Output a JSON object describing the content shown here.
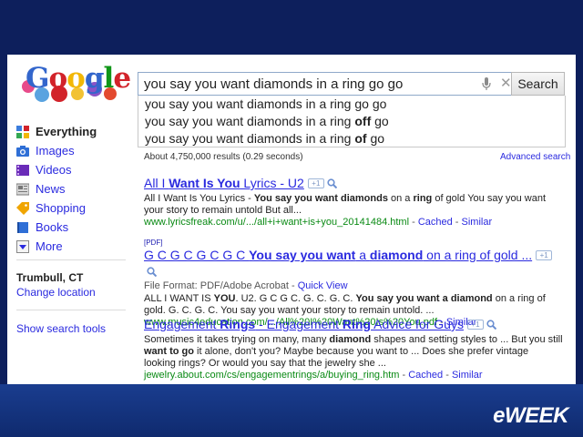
{
  "branding": {
    "publisher": "eWEEK"
  },
  "search": {
    "query": "you say you want diamonds in a ring go go",
    "button_label": "Search"
  },
  "suggestions": [
    {
      "pre": "you say you want diamonds in a ring ",
      "bold": "",
      "post": "go go"
    },
    {
      "pre": "you say you want diamonds in a ring ",
      "bold": "off",
      "post": " go"
    },
    {
      "pre": "you say you want diamonds in a ring ",
      "bold": "of",
      "post": " go"
    }
  ],
  "nav": {
    "items": [
      {
        "label": "Everything",
        "icon": "everything-icon",
        "active": true
      },
      {
        "label": "Images",
        "icon": "camera-icon"
      },
      {
        "label": "Videos",
        "icon": "film-icon"
      },
      {
        "label": "News",
        "icon": "newspaper-icon"
      },
      {
        "label": "Shopping",
        "icon": "tag-icon"
      },
      {
        "label": "Books",
        "icon": "book-icon"
      },
      {
        "label": "More",
        "icon": "chevron-down-icon"
      }
    ],
    "location": "Trumbull, CT",
    "change_location": "Change location",
    "search_tools": "Show search tools"
  },
  "stats": {
    "results": "About 4,750,000 results (0.29 seconds)",
    "advanced": "Advanced search"
  },
  "results": [
    {
      "title_a": "All I ",
      "title_b": "Want",
      "title_c": " ",
      "title_d": "Is You",
      "title_e": " Lyrics - U2",
      "plus": "+1",
      "snippet_1": "All I Want Is You Lyrics - ",
      "snippet_b1": "You say you want diamonds",
      "snippet_2": " on a ",
      "snippet_b2": "ring",
      "snippet_3": " of gold You say you want your story to remain untold But all...",
      "url": "www.lyricsfreak.com/u/.../all+i+want+is+you_20141484.html",
      "cached": "Cached",
      "similar": "Similar"
    },
    {
      "pdf": "[PDF]",
      "title_a": "G C G C G C G C ",
      "title_b": "You say you want",
      "title_c": " a ",
      "title_d": "diamond",
      "title_e": " on a ring of gold ...",
      "plus": "+1",
      "format_label": "File Format: PDF/Adobe Acrobat - ",
      "quick_view": "Quick View",
      "snippet_1": "ALL I WANT IS ",
      "snippet_b1": "YOU",
      "snippet_2": ". U2. G C G C. G. C. G. C. ",
      "snippet_b2": "You say you want a diamond",
      "snippet_3": " on a ring of gold. G. C. G. C. You say you want your story to remain untold. ...",
      "url": "www.music4education.com/.../All%20I%20Want%20Is%20You.pdf",
      "similar": "Similar"
    },
    {
      "title_a": "Engagement ",
      "title_b": "Rings",
      "title_c": " - Engagement ",
      "title_d": "Ring",
      "title_e": " Advice for Guys",
      "plus": "+1",
      "snippet_1": "Sometimes it takes trying on many, many ",
      "snippet_b1": "diamond",
      "snippet_2": " shapes and setting styles to ... But you still ",
      "snippet_b2": "want to go",
      "snippet_3": " it alone, don't you? Maybe because you want to ... Does she prefer vintage looking rings? Or would you say that the jewelry she ...",
      "url": "jewelry.about.com/cs/engagementrings/a/buying_ring.htm",
      "cached": "Cached",
      "similar": "Similar"
    }
  ]
}
